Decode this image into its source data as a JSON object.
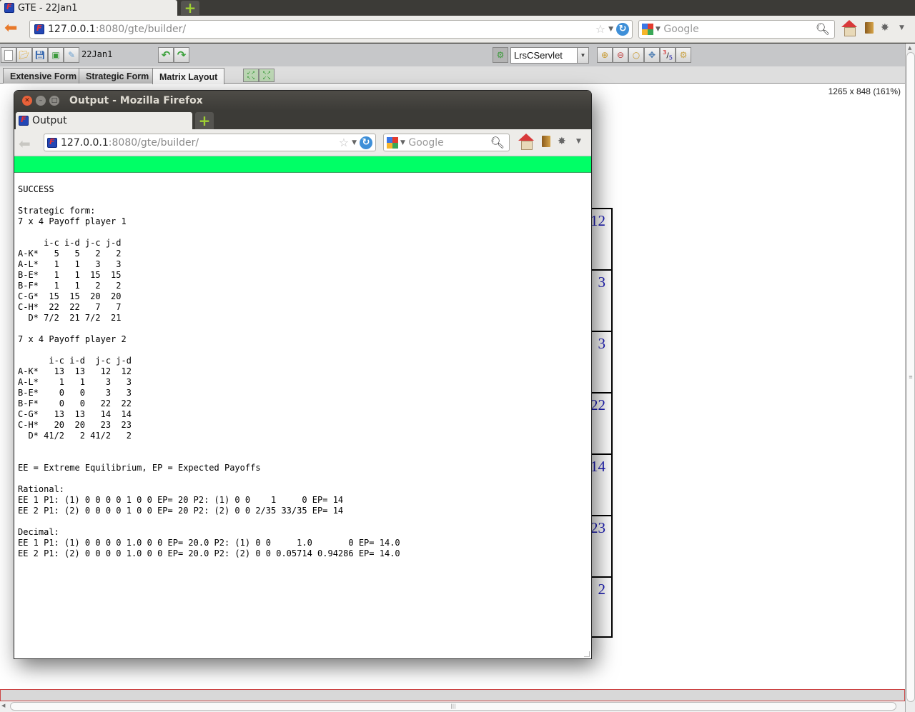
{
  "browser": {
    "tab_title": "GTE - 22Jan1",
    "url_host": "127.0.0.1",
    "url_rest": ":8080/gte/builder/",
    "search_placeholder": "Google"
  },
  "app": {
    "filename": "22Jan1",
    "servlet_selected": "LrsCServlet",
    "fraction_num": "3",
    "fraction_den": "5",
    "tabs": [
      {
        "label": "Extensive Form",
        "active": false
      },
      {
        "label": "Strategic Form",
        "active": false
      },
      {
        "label": "Matrix Layout",
        "active": true
      }
    ],
    "canvas_dims": "1265 x 848 (161%)",
    "matrix_visible_values": [
      "12",
      "3",
      "3",
      "22",
      "14",
      "23",
      "2"
    ]
  },
  "popup": {
    "window_title": "Output - Mozilla Firefox",
    "tab_title": "Output",
    "url_host": "127.0.0.1",
    "url_rest": ":8080/gte/builder/",
    "search_placeholder": "Google",
    "status_color": "#00ff66",
    "output_lines": [
      "SUCCESS",
      "",
      "Strategic form:",
      "7 x 4 Payoff player 1",
      "",
      "     i-c i-d j-c j-d",
      "A-K*   5   5   2   2",
      "A-L*   1   1   3   3",
      "B-E*   1   1  15  15",
      "B-F*   1   1   2   2",
      "C-G*  15  15  20  20",
      "C-H*  22  22   7   7",
      "  D* 7/2  21 7/2  21",
      "",
      "7 x 4 Payoff player 2",
      "",
      "      i-c i-d  j-c j-d",
      "A-K*   13  13   12  12",
      "A-L*    1   1    3   3",
      "B-E*    0   0    3   3",
      "B-F*    0   0   22  22",
      "C-G*   13  13   14  14",
      "C-H*   20  20   23  23",
      "  D* 41/2   2 41/2   2",
      "",
      "",
      "EE = Extreme Equilibrium, EP = Expected Payoffs",
      "",
      "Rational:",
      "EE 1 P1: (1) 0 0 0 0 1 0 0 EP= 20 P2: (1) 0 0    1     0 EP= 14",
      "EE 2 P1: (2) 0 0 0 0 1 0 0 EP= 20 P2: (2) 0 0 2/35 33/35 EP= 14",
      "",
      "Decimal:",
      "EE 1 P1: (1) 0 0 0 0 1.0 0 0 EP= 20.0 P2: (1) 0 0     1.0       0 EP= 14.0",
      "EE 2 P1: (2) 0 0 0 0 1.0 0 0 EP= 20.0 P2: (2) 0 0 0.05714 0.94286 EP= 14.0"
    ]
  }
}
